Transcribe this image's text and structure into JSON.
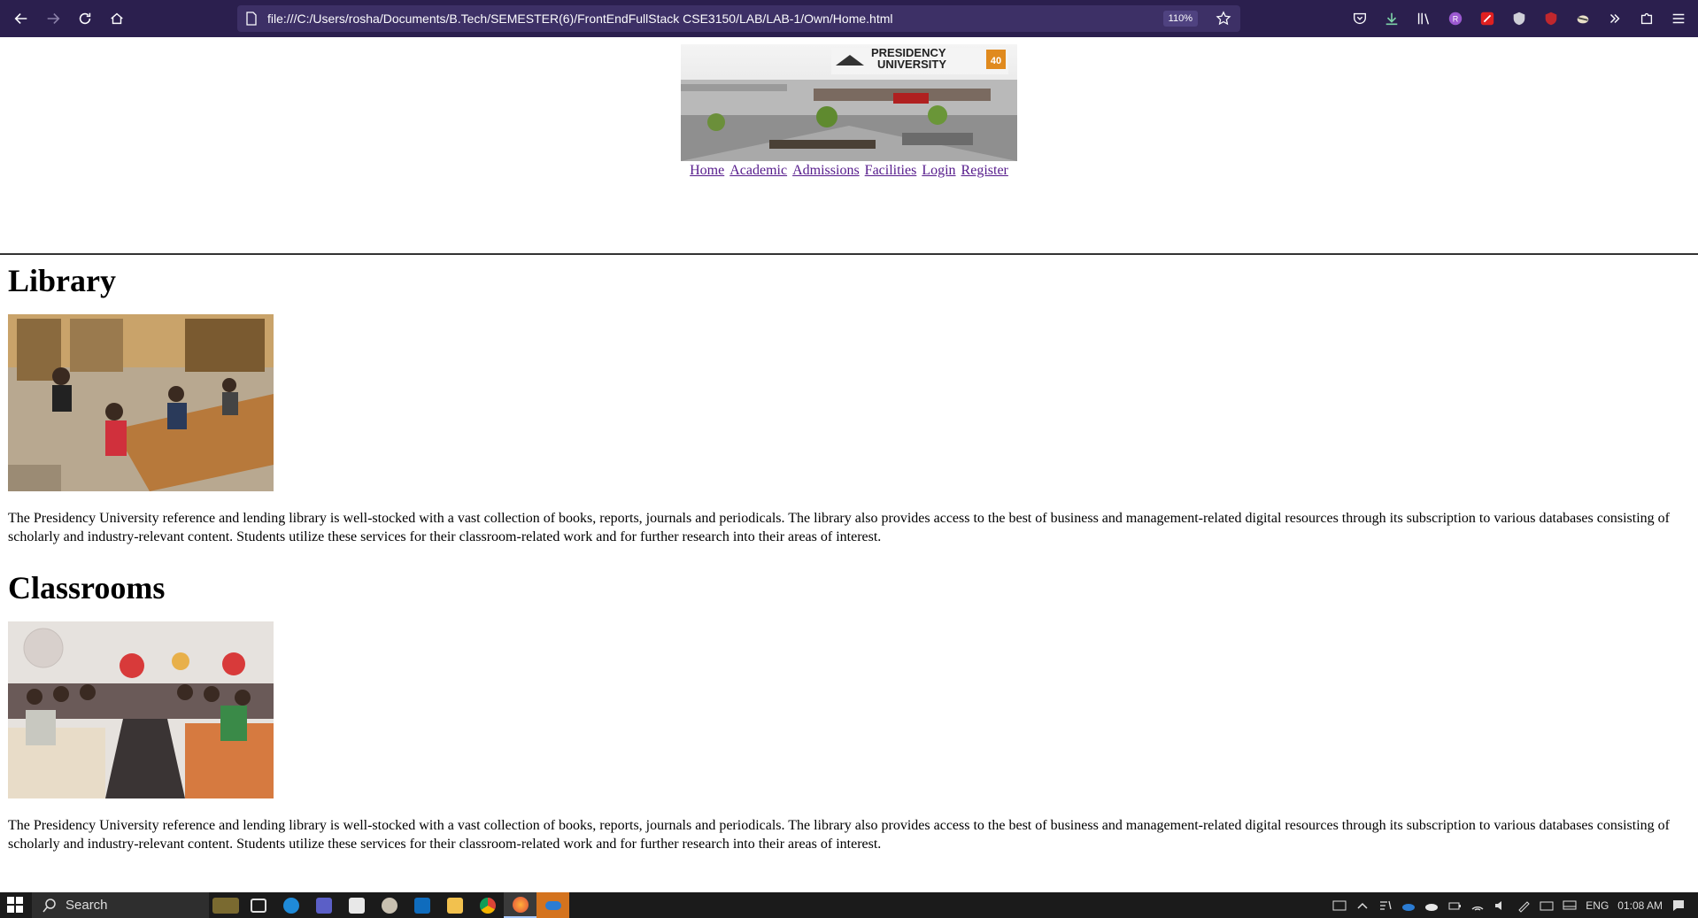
{
  "browser": {
    "url": "file:///C:/Users/rosha/Documents/B.Tech/SEMESTER(6)/FrontEndFullStack CSE3150/LAB/LAB-1/Own/Home.html",
    "zoom": "110%"
  },
  "page": {
    "banner": {
      "line1": "PRESIDENCY",
      "line2": "UNIVERSITY",
      "badge": "40"
    },
    "menu": [
      "Home",
      "Academic",
      "Admissions",
      "Facilities",
      "Login",
      "Register"
    ],
    "sections": [
      {
        "title": "Library",
        "text": "The Presidency University reference and lending library is well-stocked with a vast collection of books, reports, journals and periodicals. The library also provides access to the best of business and management-related digital resources through its subscription to various databases consisting of scholarly and industry-relevant content. Students utilize these services for their classroom-related work and for further research into their areas of interest."
      },
      {
        "title": "Classrooms",
        "text": "The Presidency University reference and lending library is well-stocked with a vast collection of books, reports, journals and periodicals. The library also provides access to the best of business and management-related digital resources through its subscription to various databases consisting of scholarly and industry-relevant content. Students utilize these services for their classroom-related work and for further research into their areas of interest."
      }
    ]
  },
  "taskbar": {
    "search_label": "Search",
    "language": "ENG",
    "time": "01:08 AM"
  },
  "colors": {
    "browser_toolbar": "#2b1f4e",
    "link_visited": "#551a8b",
    "taskbar": "#1b1b1b"
  }
}
